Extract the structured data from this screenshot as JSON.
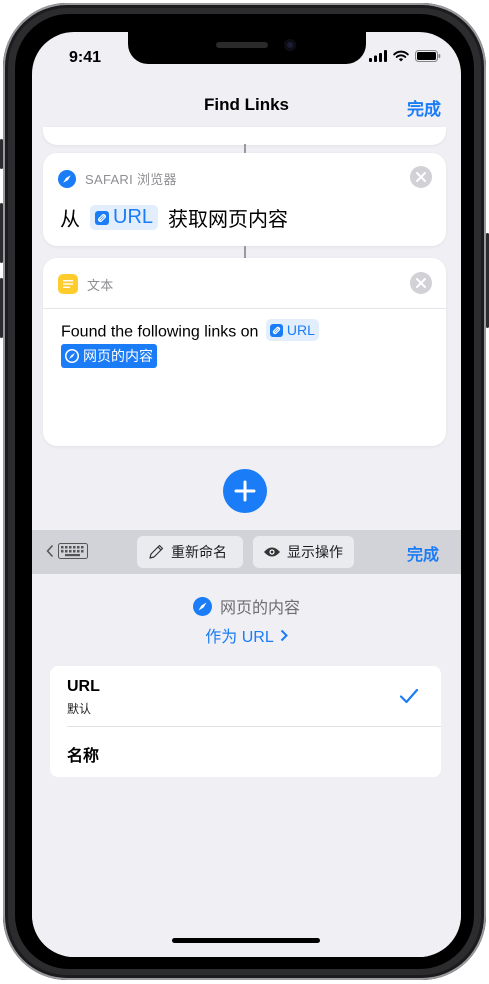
{
  "status": {
    "time": "9:41"
  },
  "nav": {
    "title": "Find Links",
    "done": "完成"
  },
  "safari_card": {
    "icon": "safari-compass-icon",
    "label": "SAFARI 浏览器",
    "prefix": "从",
    "token": "URL",
    "suffix": "获取网页内容"
  },
  "text_card": {
    "icon": "text-doc-icon",
    "label": "文本",
    "line1": "Found the following links on",
    "token1": "URL",
    "token2": "网页的内容"
  },
  "toolbar": {
    "rename": "重新命名",
    "show": "显示操作",
    "done": "完成"
  },
  "picker": {
    "title": "网页的内容",
    "as_type": "作为 URL",
    "options": [
      {
        "label": "URL",
        "sub": "默认",
        "selected": true
      },
      {
        "label": "名称",
        "sub": "",
        "selected": false
      }
    ]
  },
  "colors": {
    "accent": "#1a7cf6",
    "background": "#efeff4"
  }
}
